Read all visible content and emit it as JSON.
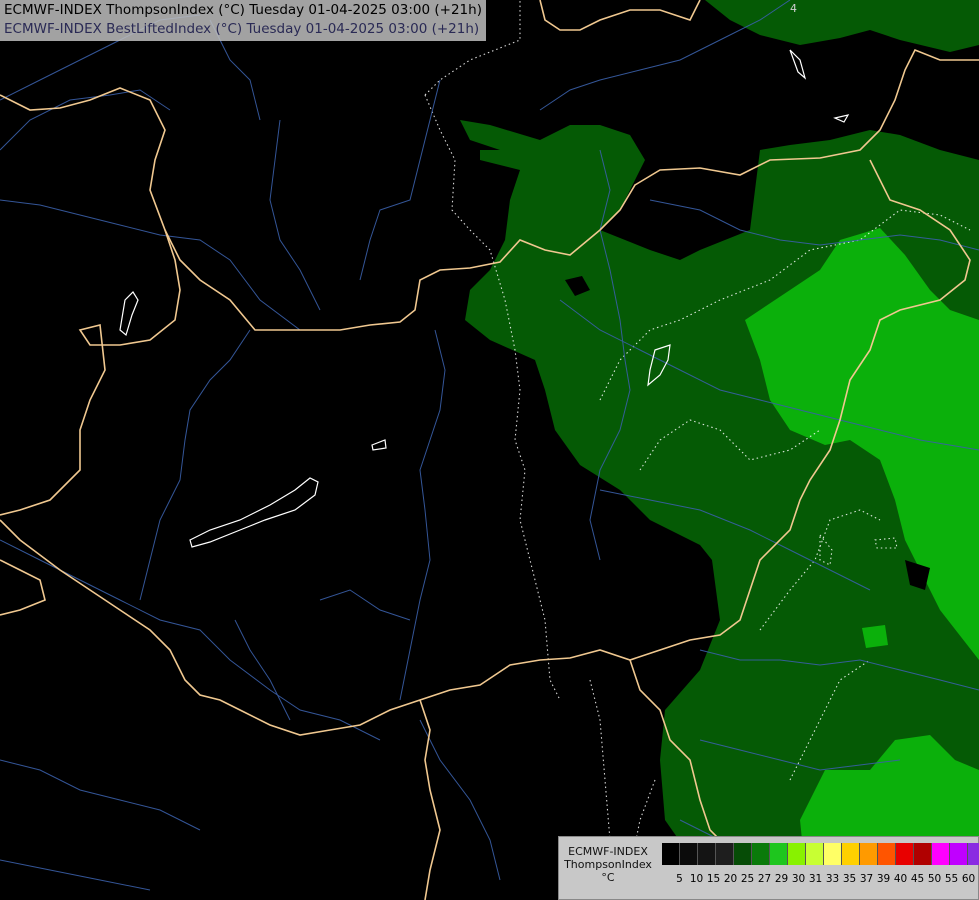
{
  "titles": {
    "line1": "ECMWF-INDEX ThompsonIndex (°C) Tuesday 01-04-2025 03:00 (+21h)",
    "line2": "ECMWF-INDEX BestLiftedIndex (°C) Tuesday 01-04-2025 03:00 (+21h)",
    "line1_color": "#000000",
    "line2_color": "#2a2a55"
  },
  "legend": {
    "model": "ECMWF-INDEX",
    "parameter": "ThompsonIndex",
    "unit": "°C",
    "colors": [
      "#000000",
      "#0b0b0b",
      "#141414",
      "#1e1e1e",
      "#064c06",
      "#0a7a0a",
      "#1ec61e",
      "#88f200",
      "#c8ff33",
      "#ffff66",
      "#ffd000",
      "#ff9a00",
      "#ff5500",
      "#e80000",
      "#b00000",
      "#ff00ff",
      "#c000ff",
      "#8a2be2",
      "#5000d0",
      "#2222ff"
    ],
    "ticks": [
      "5",
      "10",
      "15",
      "20",
      "25",
      "27",
      "29",
      "30",
      "31",
      "33",
      "35",
      "37",
      "39",
      "40",
      "45",
      "50",
      "55",
      "60"
    ]
  },
  "map": {
    "background": "#000000",
    "field_colors": {
      "low": "#064c06",
      "high": "#0ab80a"
    },
    "contour_label": "4"
  }
}
